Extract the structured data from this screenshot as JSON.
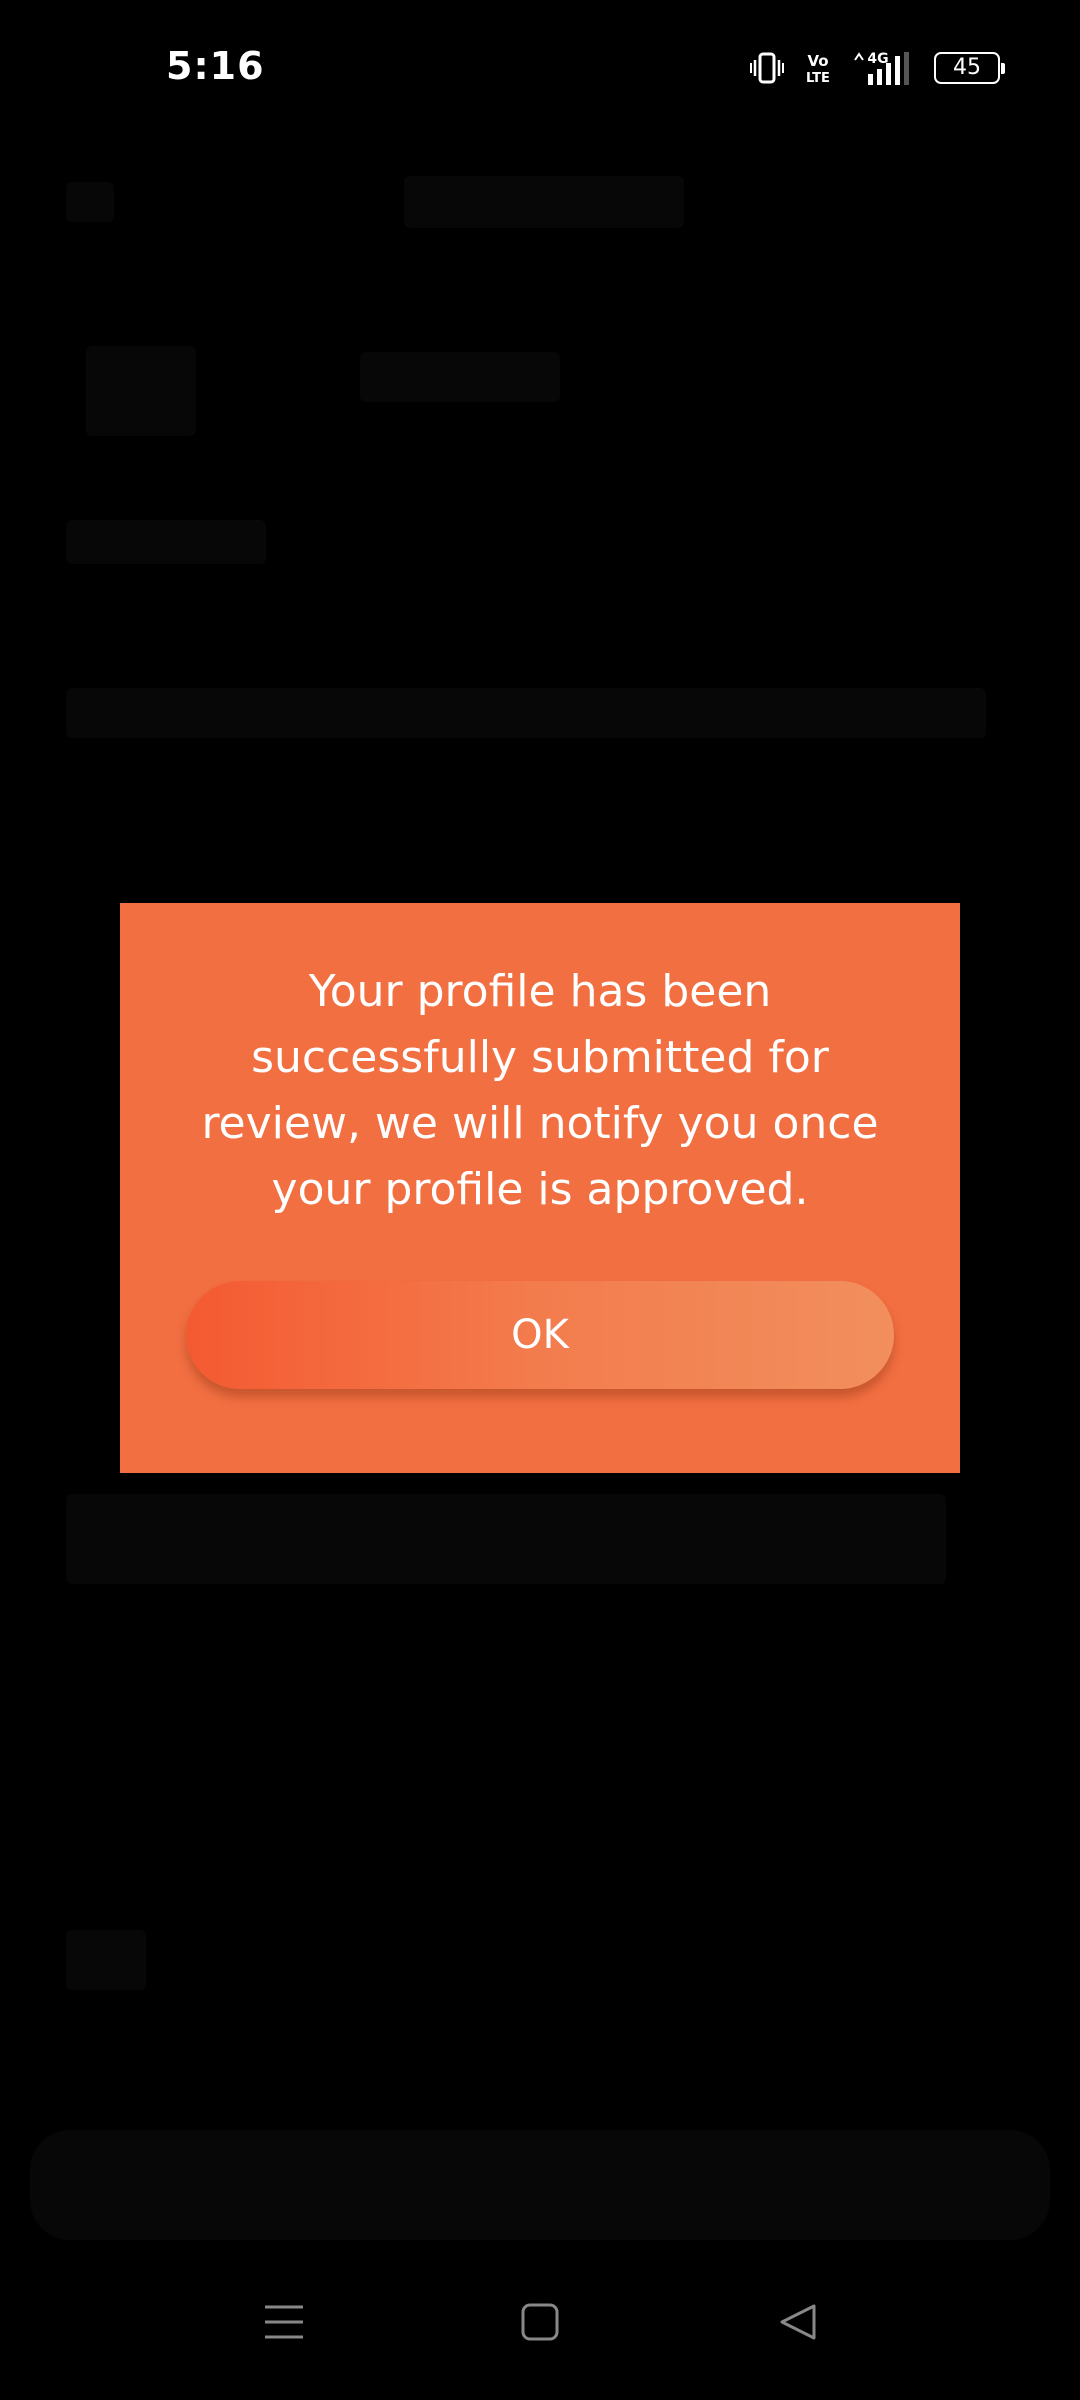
{
  "status_bar": {
    "time": "5:16",
    "battery_level": "45",
    "icons": [
      "vibrate-icon",
      "volte-icon",
      "4g-signal-icon",
      "battery-icon"
    ],
    "vo_label": "Vo",
    "lte_label": "LTE",
    "network_label": "4G"
  },
  "dialog": {
    "message": "Your profile has been successfully submitted for review, we will notify you once your profile is approved.",
    "ok_label": "OK",
    "background_color": "#f26f42"
  },
  "nav_bar": {
    "icons": [
      "menu-icon",
      "home-icon",
      "back-icon"
    ]
  }
}
